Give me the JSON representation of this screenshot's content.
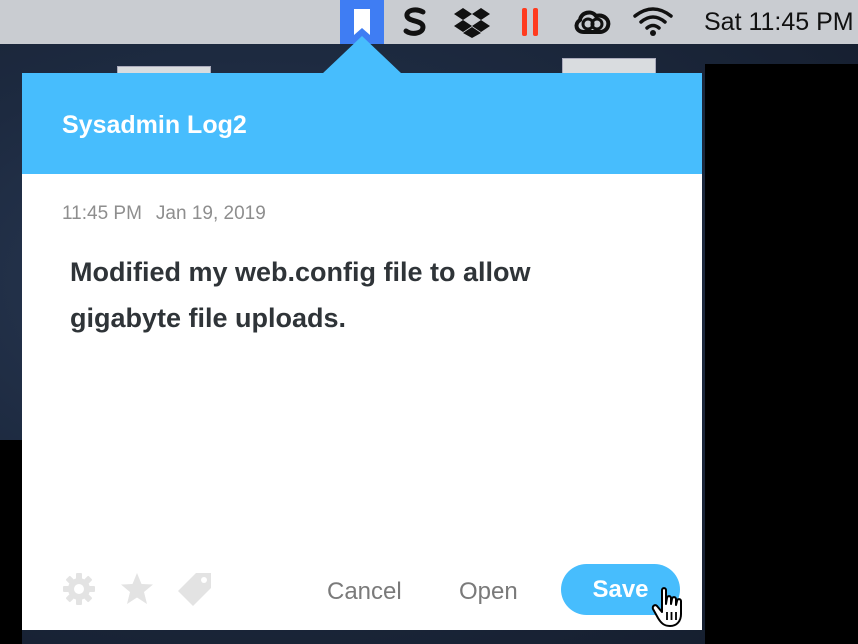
{
  "menubar": {
    "icons": [
      "bookmark-icon",
      "scrivener-s-icon",
      "dropbox-icon",
      "pause-icon",
      "creative-cloud-icon",
      "wifi-icon"
    ],
    "clock": "Sat 11:45 PM"
  },
  "popover": {
    "title": "Sysadmin Log2",
    "time": "11:45 PM",
    "date": "Jan 19, 2019",
    "note": "Modified my web.config file to allow gigabyte file uploads.",
    "footer_icons": [
      "gear-icon",
      "star-icon",
      "tag-icon"
    ],
    "cancel_label": "Cancel",
    "open_label": "Open",
    "save_label": "Save"
  },
  "colors": {
    "accent": "#47bdfd",
    "menubar": "#c9ccd1",
    "bookmark_highlight": "#3f7df3",
    "pause": "#ff3b1f"
  }
}
